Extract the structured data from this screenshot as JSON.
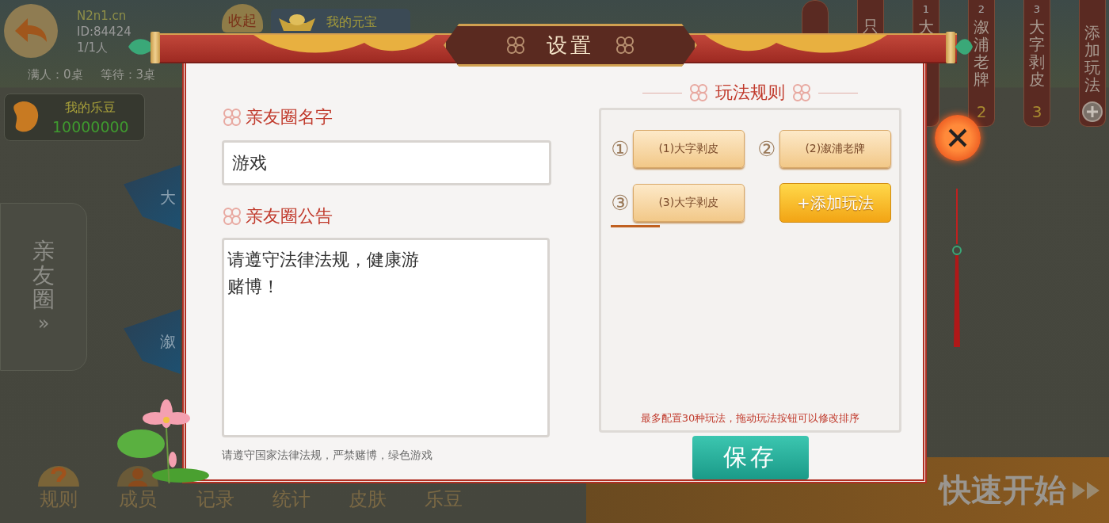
{
  "lobby": {
    "site": "N2n1.cn",
    "room_id": "ID:84424",
    "players": "1/1人",
    "full_tables": "满人：0桌",
    "waiting_tables": "等待：3桌",
    "collapse_button": "收起",
    "ingot_label": "我的元宝",
    "beans_label": "我的乐豆",
    "beans_value": "10000000",
    "side_tab": {
      "label": "亲友圈",
      "chevron": "»"
    },
    "tables": [
      {
        "label": "大"
      },
      {
        "label": "溆"
      }
    ],
    "rule_tabs": [
      {
        "kind": "blank"
      },
      {
        "kind": "text",
        "label": "只"
      },
      {
        "kind": "rule",
        "number": "1",
        "label": "大"
      },
      {
        "kind": "rule",
        "number": "2",
        "label": "溆浦老牌",
        "badge": "2"
      },
      {
        "kind": "rule",
        "number": "3",
        "label": "大字剥皮",
        "badge": "3"
      },
      {
        "kind": "add",
        "label": "添加玩法"
      }
    ],
    "bottom_menu": [
      {
        "kind": "help",
        "label": "规则"
      },
      {
        "kind": "member",
        "label": "成员"
      },
      {
        "kind": "plain",
        "label": "记录"
      },
      {
        "kind": "plain",
        "label": "统计"
      },
      {
        "kind": "plain",
        "label": "皮肤"
      },
      {
        "kind": "plain",
        "label": "乐豆"
      }
    ],
    "quick_start": "快速开始"
  },
  "dialog": {
    "title": "设置",
    "name_label": "亲友圈名字",
    "name_value": "游戏",
    "notice_label": "亲友圈公告",
    "notice_lines": [
      "请遵守法律法规，健康游",
      "赌博！"
    ],
    "footnote": "请遵守国家法律法规，严禁赌博，绿色游戏",
    "rules_title": "玩法规则",
    "rules": [
      {
        "number": "①",
        "label": "(1)大字剥皮"
      },
      {
        "number": "②",
        "label": "(2)溆浦老牌"
      },
      {
        "number": "③",
        "label": "(3)大字剥皮"
      }
    ],
    "add_rule": "+添加玩法",
    "rules_hint": "最多配置30种玩法，拖动玩法按钮可以修改排序",
    "save": "保存"
  }
}
